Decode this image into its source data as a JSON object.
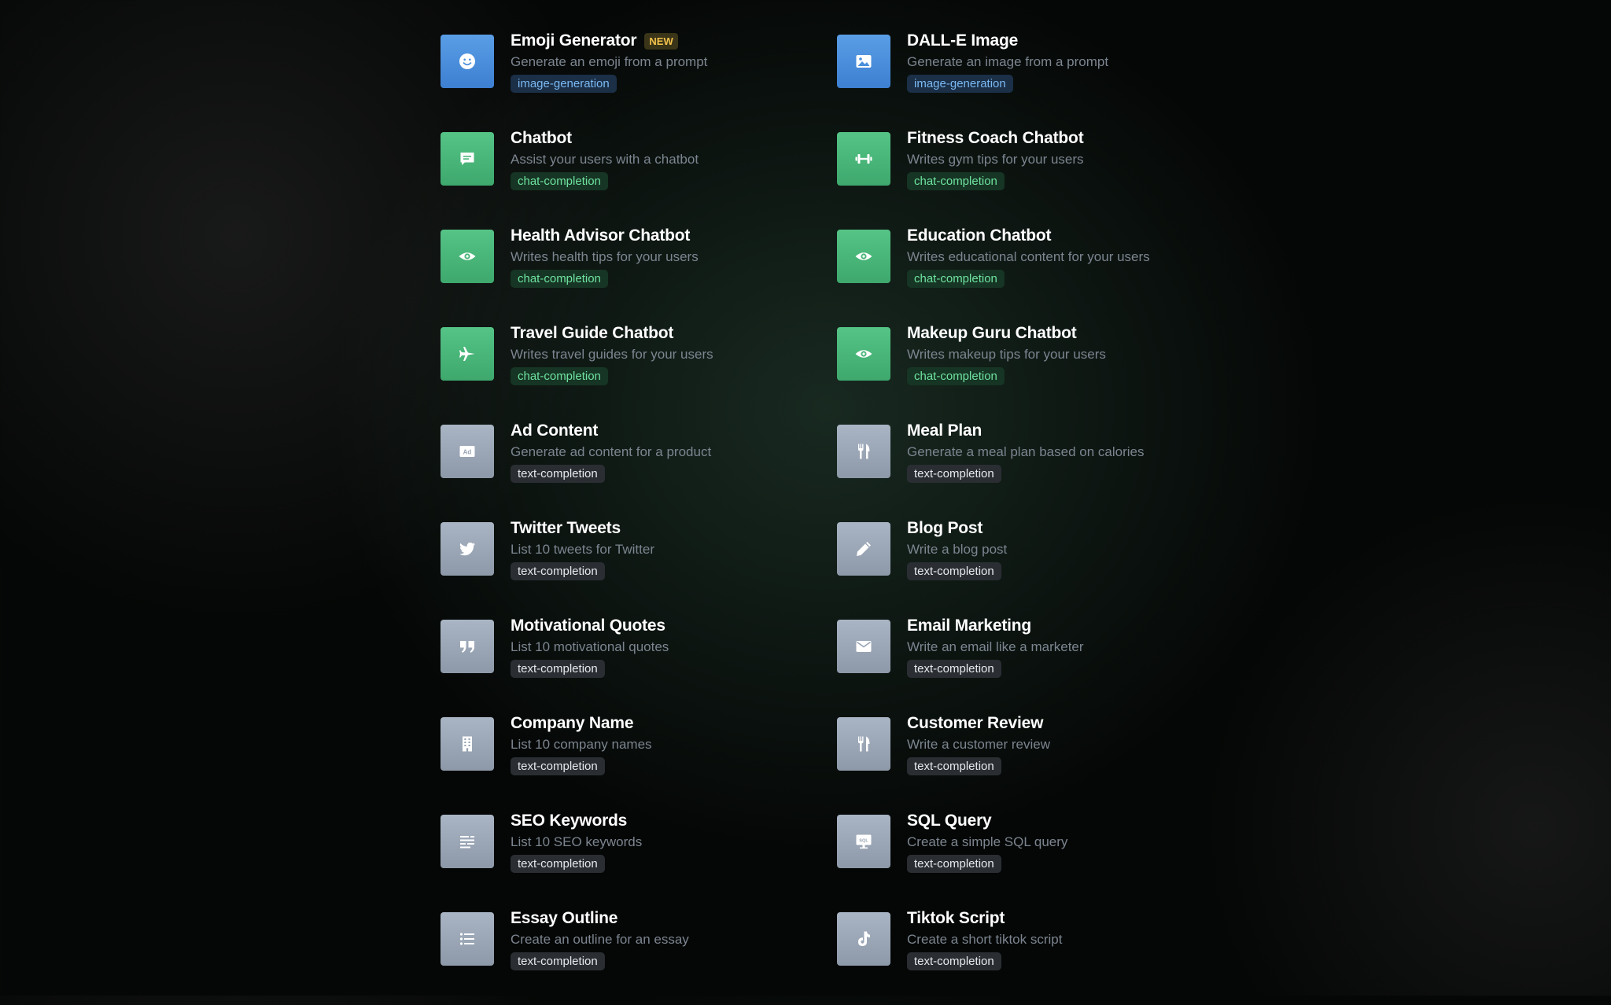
{
  "colors": {
    "image_generation": "#4a8fdc",
    "chat_completion": "#4bb77a",
    "text_completion": "#98a4b3",
    "new_badge": "#f3c24a"
  },
  "cards": [
    {
      "title": "Emoji Generator",
      "badge": "NEW",
      "description": "Generate an emoji from a prompt",
      "tag": "image-generation",
      "icon": "smiley-icon"
    },
    {
      "title": "DALL-E Image",
      "description": "Generate an image from a prompt",
      "tag": "image-generation",
      "icon": "image-icon"
    },
    {
      "title": "Chatbot",
      "description": "Assist your users with a chatbot",
      "tag": "chat-completion",
      "icon": "chat-bubble-icon"
    },
    {
      "title": "Fitness Coach Chatbot",
      "description": "Writes gym tips for your users",
      "tag": "chat-completion",
      "icon": "dumbbell-icon"
    },
    {
      "title": "Health Advisor Chatbot",
      "description": "Writes health tips for your users",
      "tag": "chat-completion",
      "icon": "eye-icon"
    },
    {
      "title": "Education Chatbot",
      "description": "Writes educational content for your users",
      "tag": "chat-completion",
      "icon": "eye-icon"
    },
    {
      "title": "Travel Guide Chatbot",
      "description": "Writes travel guides for your users",
      "tag": "chat-completion",
      "icon": "airplane-icon"
    },
    {
      "title": "Makeup Guru Chatbot",
      "description": "Writes makeup tips for your users",
      "tag": "chat-completion",
      "icon": "eye-icon"
    },
    {
      "title": "Ad Content",
      "description": "Generate ad content for a product",
      "tag": "text-completion",
      "icon": "ad-icon"
    },
    {
      "title": "Meal Plan",
      "description": "Generate a meal plan based on calories",
      "tag": "text-completion",
      "icon": "utensils-icon"
    },
    {
      "title": "Twitter Tweets",
      "description": "List 10 tweets for Twitter",
      "tag": "text-completion",
      "icon": "twitter-bird-icon"
    },
    {
      "title": "Blog Post",
      "description": "Write a blog post",
      "tag": "text-completion",
      "icon": "pencil-icon"
    },
    {
      "title": "Motivational Quotes",
      "description": "List 10 motivational quotes",
      "tag": "text-completion",
      "icon": "quote-icon"
    },
    {
      "title": "Email Marketing",
      "description": "Write an email like a marketer",
      "tag": "text-completion",
      "icon": "envelope-icon"
    },
    {
      "title": "Company Name",
      "description": "List 10 company names",
      "tag": "text-completion",
      "icon": "building-icon"
    },
    {
      "title": "Customer Review",
      "description": "Write a customer review",
      "tag": "text-completion",
      "icon": "utensils-icon"
    },
    {
      "title": "SEO Keywords",
      "description": "List 10 SEO keywords",
      "tag": "text-completion",
      "icon": "text-lines-icon"
    },
    {
      "title": "SQL Query",
      "description": "Create a simple SQL query",
      "tag": "text-completion",
      "icon": "sql-monitor-icon"
    },
    {
      "title": "Essay Outline",
      "description": "Create an outline for an essay",
      "tag": "text-completion",
      "icon": "list-icon"
    },
    {
      "title": "Tiktok Script",
      "description": "Create a short tiktok script",
      "tag": "text-completion",
      "icon": "tiktok-icon"
    }
  ]
}
